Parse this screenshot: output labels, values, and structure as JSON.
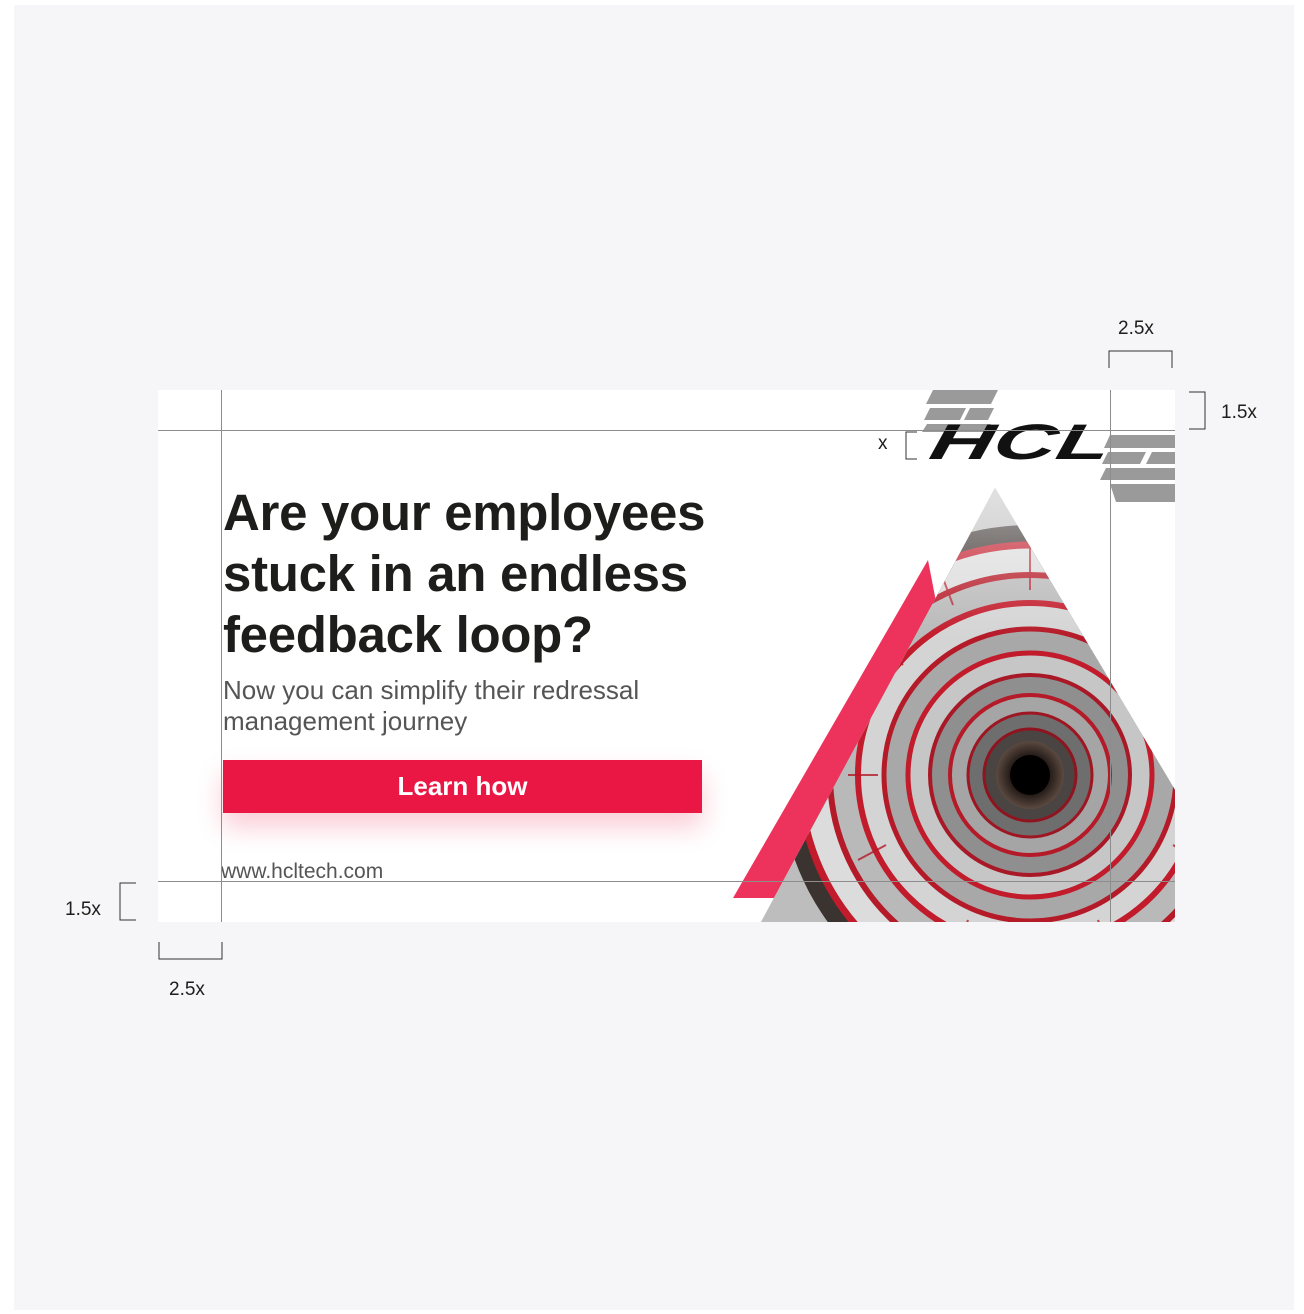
{
  "ad": {
    "headline": [
      "Are your employees",
      "stuck in an endless",
      "feedback loop?"
    ],
    "subhead": [
      "Now you can simplify their redressal",
      "management journey"
    ],
    "cta_label": "Learn how",
    "url": "www.hcltech.com",
    "logo_text": "HCL",
    "brand_color": "#ea1745",
    "text_color": "#1d1d1b"
  },
  "annotations": {
    "top_right_width": "2.5x",
    "top_right_height": "1.5x",
    "logo_height": "x",
    "bottom_left_height": "1.5x",
    "bottom_left_width": "2.5x"
  }
}
